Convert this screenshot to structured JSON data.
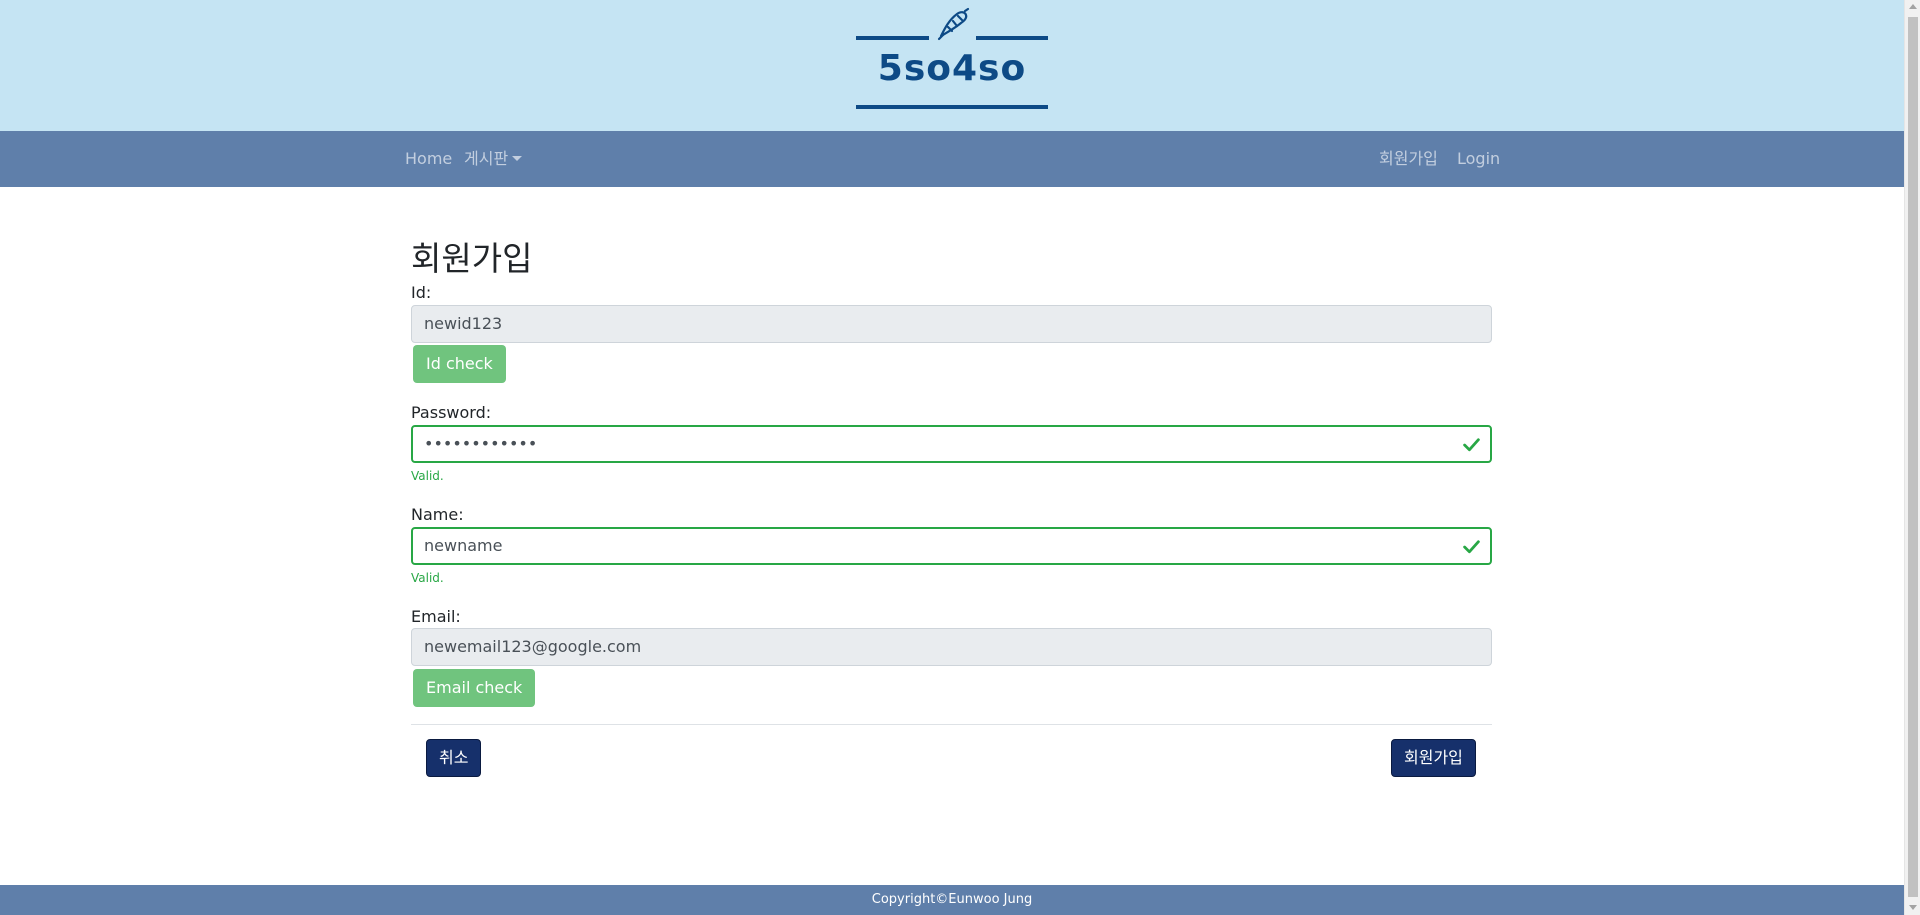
{
  "brand": {
    "title": "5so4so",
    "icon": "croissant-icon"
  },
  "nav": {
    "home": "Home",
    "board": "게시판",
    "signup": "회원가입",
    "login": "Login"
  },
  "form": {
    "title": "회원가입",
    "id": {
      "label": "Id:",
      "value": "newid123",
      "check_button": "Id check"
    },
    "password": {
      "label": "Password:",
      "value": "••••••••••••",
      "feedback": "Valid."
    },
    "name": {
      "label": "Name:",
      "value": "newname",
      "feedback": "Valid."
    },
    "email": {
      "label": "Email:",
      "value": "newemail123@google.com",
      "check_button": "Email check"
    },
    "cancel_button": "취소",
    "submit_button": "회원가입"
  },
  "footer": {
    "copyright": "Copyright©Eunwoo Jung"
  },
  "colors": {
    "banner": "#c5e4f3",
    "brand": "#0d4a86",
    "navbar": "#5f7faa",
    "valid": "#28a745",
    "check_button": "#70c47e",
    "primary_button": "#16306b"
  }
}
